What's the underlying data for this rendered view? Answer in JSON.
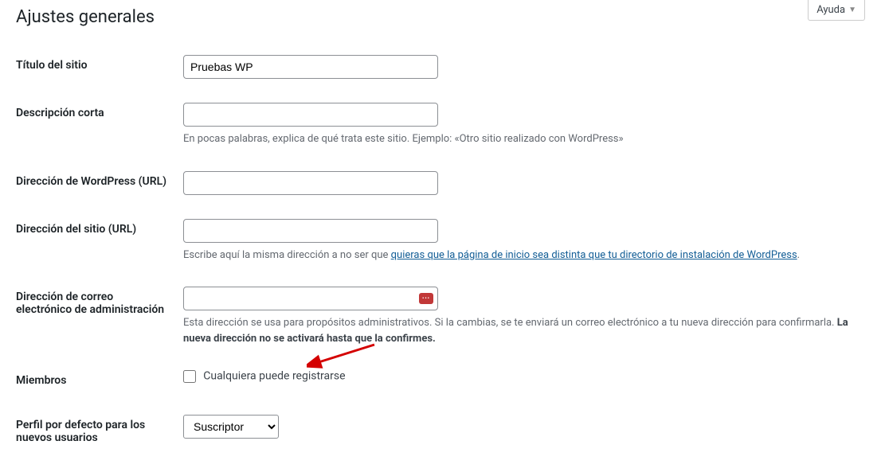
{
  "help_tab": {
    "label": "Ayuda"
  },
  "page_title": "Ajustes generales",
  "fields": {
    "site_title": {
      "label": "Título del sitio",
      "value": "Pruebas WP"
    },
    "tagline": {
      "label": "Descripción corta",
      "value": "",
      "description": "En pocas palabras, explica de qué trata este sitio. Ejemplo: «Otro sitio realizado con WordPress»"
    },
    "wp_url": {
      "label": "Dirección de WordPress (URL)",
      "value": ""
    },
    "site_url": {
      "label": "Dirección del sitio (URL)",
      "value": "",
      "description_prefix": "Escribe aquí la misma dirección a no ser que ",
      "description_link": "quieras que la página de inicio sea distinta que tu directorio de instalación de WordPress",
      "description_suffix": "."
    },
    "admin_email": {
      "label": "Dirección de correo electrónico de administración",
      "value": "",
      "description_prefix": "Esta dirección se usa para propósitos administrativos. Si la cambias, se te enviará un correo electrónico a tu nueva dirección para confirmarla. ",
      "description_strong": "La nueva dirección no se activará hasta que la confirmes."
    },
    "membership": {
      "label": "Miembros",
      "checkbox_label": "Cualquiera puede registrarse",
      "checked": false
    },
    "default_role": {
      "label": "Perfil por defecto para los nuevos usuarios",
      "selected": "Suscriptor"
    }
  }
}
